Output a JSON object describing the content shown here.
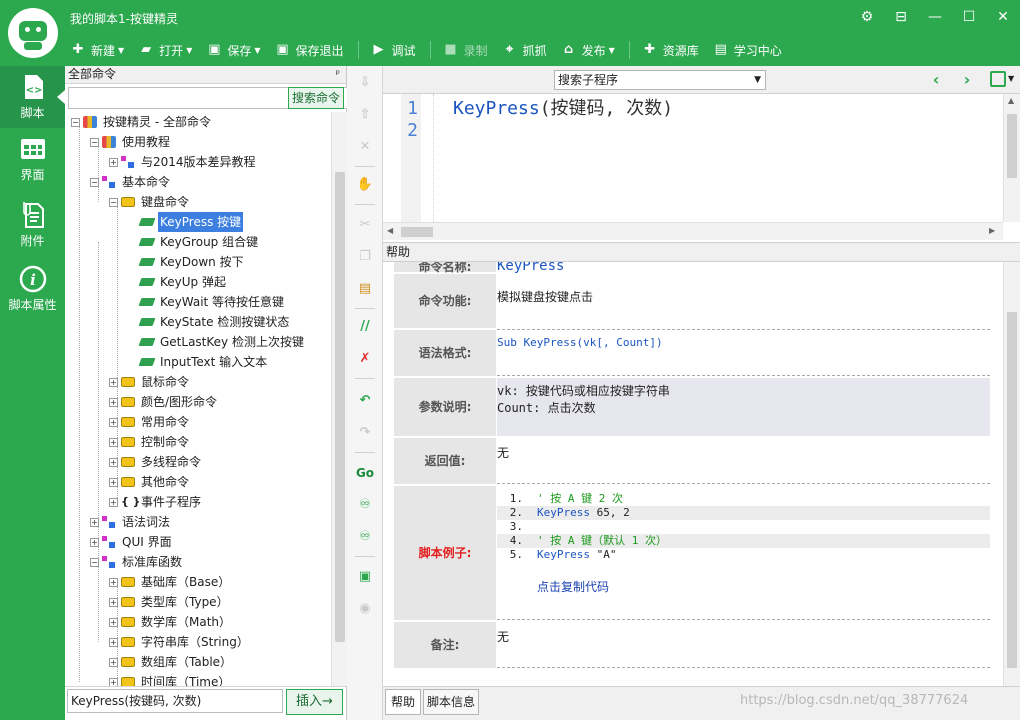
{
  "window": {
    "title": "我的脚本1-按键精灵",
    "controls": [
      "⚙",
      "⊟",
      "—",
      "☐",
      "✕"
    ]
  },
  "toolbar": {
    "new": "新建",
    "open": "打开",
    "save": "保存",
    "save_exit": "保存退出",
    "debug": "调试",
    "record": "录制",
    "capture": "抓抓",
    "publish": "发布",
    "resources": "资源库",
    "learning": "学习中心"
  },
  "sidenav": {
    "items": [
      {
        "label": "脚本"
      },
      {
        "label": "界面"
      },
      {
        "label": "附件"
      },
      {
        "label": "脚本属性"
      }
    ]
  },
  "cmdpanel": {
    "title": "全部命令",
    "pin": "ᵖ",
    "search_value": "",
    "search_button": "搜索命令",
    "footer_value": "KeyPress(按键码, 次数)",
    "insert_button": "插入→"
  },
  "tree": [
    {
      "label": "按键精灵 - 全部命令",
      "exp": "−",
      "icon": "book",
      "level": 0
    },
    {
      "label": "使用教程",
      "exp": "−",
      "icon": "book",
      "level": 1
    },
    {
      "label": "与2014版本差异教程",
      "exp": "+",
      "icon": "blocks",
      "level": 2
    },
    {
      "label": "基本命令",
      "exp": "−",
      "icon": "blocks",
      "level": 1
    },
    {
      "label": "键盘命令",
      "exp": "−",
      "icon": "keys",
      "level": 2
    },
    {
      "label": "KeyPress 按键",
      "exp": "",
      "icon": "cmd",
      "level": 3,
      "selected": true
    },
    {
      "label": "KeyGroup 组合键",
      "exp": "",
      "icon": "cmd",
      "level": 3
    },
    {
      "label": "KeyDown 按下",
      "exp": "",
      "icon": "cmd",
      "level": 3
    },
    {
      "label": "KeyUp 弹起",
      "exp": "",
      "icon": "cmd",
      "level": 3
    },
    {
      "label": "KeyWait 等待按任意键",
      "exp": "",
      "icon": "cmd",
      "level": 3
    },
    {
      "label": "KeyState 检测按键状态",
      "exp": "",
      "icon": "cmd",
      "level": 3
    },
    {
      "label": "GetLastKey 检测上次按键",
      "exp": "",
      "icon": "cmd",
      "level": 3
    },
    {
      "label": "InputText 输入文本",
      "exp": "",
      "icon": "cmd",
      "level": 3
    },
    {
      "label": "鼠标命令",
      "exp": "+",
      "icon": "keys",
      "level": 2
    },
    {
      "label": "颜色/图形命令",
      "exp": "+",
      "icon": "keys",
      "level": 2
    },
    {
      "label": "常用命令",
      "exp": "+",
      "icon": "keys",
      "level": 2
    },
    {
      "label": "控制命令",
      "exp": "+",
      "icon": "keys",
      "level": 2
    },
    {
      "label": "多线程命令",
      "exp": "+",
      "icon": "keys",
      "level": 2
    },
    {
      "label": "其他命令",
      "exp": "+",
      "icon": "keys",
      "level": 2
    },
    {
      "label": "事件子程序",
      "exp": "+",
      "icon": "brace",
      "level": 2
    },
    {
      "label": "语法词法",
      "exp": "+",
      "icon": "blocks",
      "level": 1
    },
    {
      "label": "QUI 界面",
      "exp": "+",
      "icon": "blocks",
      "level": 1
    },
    {
      "label": "标准库函数",
      "exp": "−",
      "icon": "blocks",
      "level": 1
    },
    {
      "label": "基础库（Base）",
      "exp": "+",
      "icon": "keys",
      "level": 2
    },
    {
      "label": "类型库（Type）",
      "exp": "+",
      "icon": "keys",
      "level": 2
    },
    {
      "label": "数学库（Math）",
      "exp": "+",
      "icon": "keys",
      "level": 2
    },
    {
      "label": "字符串库（String）",
      "exp": "+",
      "icon": "keys",
      "level": 2
    },
    {
      "label": "数组库（Table）",
      "exp": "+",
      "icon": "keys",
      "level": 2
    },
    {
      "label": "时间库（Time）",
      "exp": "+",
      "icon": "keys",
      "level": 2
    }
  ],
  "editor": {
    "sub_select": "搜索子程序",
    "line_numbers": "1\n2",
    "code_func": "KeyPress",
    "code_args": "(按键码, 次数)"
  },
  "help": {
    "title": "帮助",
    "partial_label": "命令名称:",
    "partial_value": "KeyPress",
    "function_label": "命令功能:",
    "function_value": "模拟键盘按键点击",
    "syntax_label": "语法格式:",
    "syntax_value": "Sub KeyPress(vk[, Count])",
    "params_label": "参数说明:",
    "params_line1": "vk: 按键代码或相应按键字符串",
    "params_line2": "Count: 点击次数",
    "return_label": "返回值:",
    "return_value": "无",
    "example_label": "脚本例子:",
    "example_lines": [
      {
        "num": "1.",
        "text": "' 按 A 键 2 次",
        "kind": "comment"
      },
      {
        "num": "2.",
        "kw": "KeyPress",
        "text": " 65, 2",
        "kind": "code"
      },
      {
        "num": "3.",
        "text": "",
        "kind": "blank"
      },
      {
        "num": "4.",
        "text": "' 按 A 键（默认 1 次）",
        "kind": "comment"
      },
      {
        "num": "5.",
        "kw": "KeyPress",
        "text": " \"A\"",
        "kind": "code"
      }
    ],
    "copy_link": "点击复制代码",
    "notes_label": "备注:",
    "notes_value": "无"
  },
  "bottom_tabs": {
    "help": "帮助",
    "script_info": "脚本信息"
  },
  "watermark": "https://blog.csdn.net/qq_38777624",
  "colors": {
    "brand_green": "#2ca84f",
    "selection_blue": "#3d7fe0",
    "keyword_blue": "#1a55c2",
    "comment_green": "#1c9a1c",
    "warning_red": "#e41e1e"
  }
}
